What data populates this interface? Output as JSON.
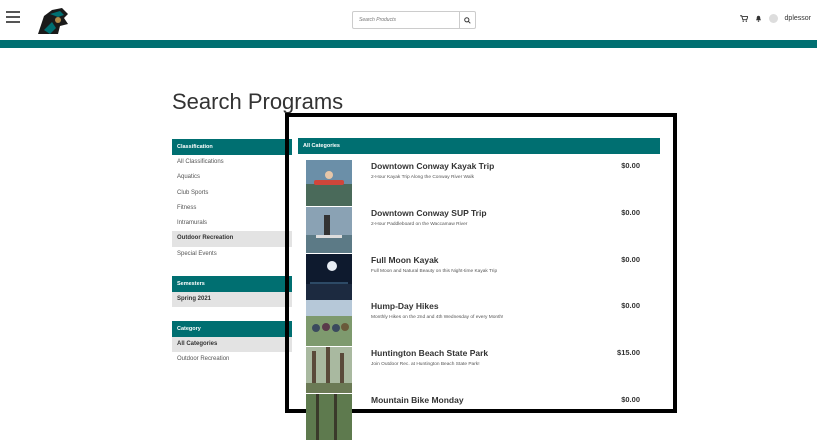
{
  "header": {
    "search_placeholder": "Search Products",
    "username": "dplessor",
    "search_icon": "search-icon",
    "cart_icon": "cart-icon",
    "bell_icon": "bell-icon"
  },
  "colors": {
    "brand": "#006f71"
  },
  "page_title": "Search Programs",
  "sidebar": {
    "classification": {
      "heading": "Classification",
      "items": [
        "All Classifications",
        "Aquatics",
        "Club Sports",
        "Fitness",
        "Intramurals",
        "Outdoor Recreation",
        "Special Events"
      ],
      "selected": "Outdoor Recreation"
    },
    "semesters": {
      "heading": "Semesters",
      "items": [
        "Spring 2021"
      ],
      "selected": "Spring 2021"
    },
    "category": {
      "heading": "Category",
      "items": [
        "All Categories",
        "Outdoor Recreation"
      ],
      "selected": "All Categories"
    }
  },
  "main": {
    "heading": "All Categories",
    "programs": [
      {
        "name": "Downtown Conway Kayak Trip",
        "desc": "2-Hour Kayak Trip Along the Conway River Walk",
        "price": "$0.00"
      },
      {
        "name": "Downtown Conway SUP Trip",
        "desc": "2-Hour Paddleboard on the Waccamaw River",
        "price": "$0.00"
      },
      {
        "name": "Full Moon Kayak",
        "desc": "Full Moon and Natural Beauty on this Night-time Kayak Trip",
        "price": "$0.00"
      },
      {
        "name": "Hump-Day Hikes",
        "desc": "Monthly Hikes on the 2nd and 4th Wednesday of every Month!",
        "price": "$0.00"
      },
      {
        "name": "Huntington Beach State Park",
        "desc": "Join Outdoor Rec. at Huntington Beach State Park!",
        "price": "$15.00"
      },
      {
        "name": "Mountain Bike Monday",
        "desc": "",
        "price": "$0.00"
      }
    ]
  }
}
